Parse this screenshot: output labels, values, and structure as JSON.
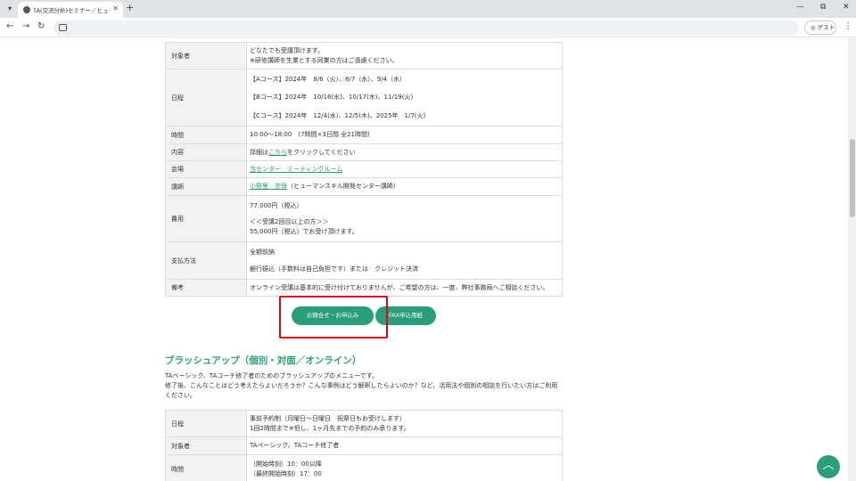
{
  "browser": {
    "tab_title": "TA(交流分析)セミナー／ヒューマンスキ",
    "new_tab": "+",
    "profile": "ゲスト",
    "minimize": "—",
    "restore": "⧉",
    "close": "✕"
  },
  "table1": {
    "rows": [
      {
        "label": "対象者",
        "lines": [
          "どなたでも受講頂けます。",
          "※研修講師を生業とする同業の方はご遠慮ください。"
        ]
      },
      {
        "label": "日程",
        "lines": [
          "【Aコース】2024年　8/6（火）、8/7（水）、9/4（水）",
          "【Bコース】2024年　10/16(水)、10/17(木)、11/19(火)",
          "【Cコース】2024年　12/4(水)、12/5(木)、2025年　1/7(火)"
        ]
      },
      {
        "label": "時間",
        "lines": [
          "10:00～18:00　(7時間×3日間 全21時間)"
        ]
      },
      {
        "label": "内容",
        "prefix": "詳細は",
        "link": "こちら",
        "suffix": "をクリックしてください"
      },
      {
        "label": "会場",
        "link": "当センター　ミーティングルーム"
      },
      {
        "label": "講師",
        "link": "小野里　宗保",
        "suffix": "（ヒューマンスキル開発センター講師）"
      },
      {
        "label": "費用",
        "lines": [
          "77,000円（税込）",
          "",
          "＜＜受講2回目以上の方＞＞",
          "55,000円（税込）でお受け頂けます。"
        ]
      },
      {
        "label": "支払方法",
        "lines": [
          "全額前納",
          "",
          "銀行振込（手数料は自己負担です）または　クレジット決済"
        ]
      },
      {
        "label": "備考",
        "lines": [
          "オンライン受講は基本的に受け付けておりませんが、ご希望の方は、一度、弊社事務局へご相談ください。"
        ]
      }
    ]
  },
  "buttons": {
    "inquiry": "お問合せ・お申込み",
    "fax": "FAX申込用紙"
  },
  "section": {
    "title": "ブラッシュアップ（個別・対面／オンライン）",
    "intro_1": "TAベーシック、TAコーチ修了者のためのブラッシュアップのメニューです。",
    "intro_2": "修了後、こんなことはどう考えたらよいだろうか？こんな事例はどう解釈したらよいのか？など、活用法や個別の相談を行いたい方はご利用ください。"
  },
  "table2": {
    "rows": [
      {
        "label": "日程",
        "lines": [
          "事前予約制（月曜日～日曜日　祝祭日もお受けします）",
          "1回2時間まで※但し、1ヶ月先までの予約のみ承ります。"
        ]
      },
      {
        "label": "対象者",
        "lines": [
          "TAベーシック、TAコーチ修了者"
        ]
      },
      {
        "label": "時間",
        "lines": [
          "（開始時刻）10：00以降",
          "（最終開始時刻）17：00"
        ]
      }
    ]
  }
}
